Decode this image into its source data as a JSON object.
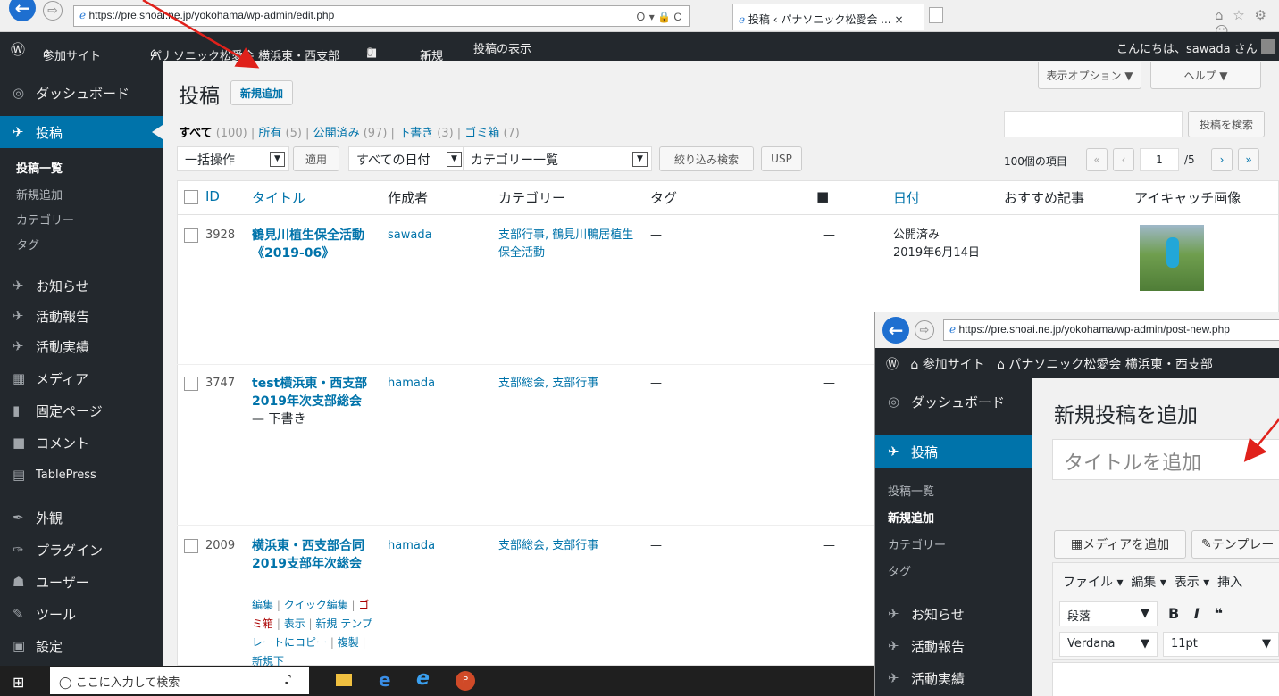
{
  "browser": {
    "url": "https://pre.shoai.ne.jp/yokohama/wp-admin/edit.php",
    "search_glyph": "Ｏ ▾ 🔒 C",
    "tab_title": "投稿 ‹ パナソニック松愛会 ...",
    "tab_close": "×",
    "right_icons": "⌂ ☆ ⚙ ☺"
  },
  "adminbar": {
    "wp_icon": "Ⓦ",
    "mysites": "参加サイト",
    "site": "パナソニック松愛会 横浜東・西支部",
    "comments": "0",
    "new": "新規",
    "view": "投稿の表示",
    "greeting": "こんにちは、sawada さん"
  },
  "sidebar": {
    "dashboard": "ダッシュボード",
    "posts": "投稿",
    "sub": [
      "投稿一覧",
      "新規追加",
      "カテゴリー",
      "タグ"
    ],
    "items": [
      "お知らせ",
      "活動報告",
      "活動実績",
      "メディア",
      "固定ページ",
      "コメント",
      "TablePress",
      "外観",
      "プラグイン",
      "ユーザー",
      "ツール",
      "設定"
    ]
  },
  "main": {
    "title": "投稿",
    "add_new": "新規追加",
    "screen_options": "表示オプション ▼",
    "help": "ヘルプ ▼",
    "filters": {
      "all": "すべて",
      "all_count": "(100)",
      "mine": "所有",
      "mine_count": "(5)",
      "published": "公開済み",
      "published_count": "(97)",
      "draft": "下書き",
      "draft_count": "(3)",
      "trash": "ゴミ箱",
      "trash_count": "(7)"
    },
    "search_button": "投稿を検索",
    "bulk": "一括操作",
    "apply": "適用",
    "dates": "すべての日付",
    "categories": "カテゴリー一覧",
    "filter": "絞り込み検索",
    "usp": "USP",
    "items_count": "100個の項目",
    "page": "1",
    "pages": "/5",
    "columns": [
      "ID",
      "タイトル",
      "作成者",
      "カテゴリー",
      "タグ",
      "日付",
      "おすすめ記事",
      "アイキャッチ画像"
    ],
    "rows": [
      {
        "id": "3928",
        "title": "鶴見川植生保全活動《2019-06》",
        "author": "sawada",
        "cats": "支部行事, 鶴見川鴨居植生保全活動",
        "tags": "—",
        "comments": "—",
        "status": "公開済み",
        "date": "2019年6月14日"
      },
      {
        "id": "3747",
        "title": "test横浜東・西支部2019年次支部総会",
        "state": "— 下書き",
        "author": "hamada",
        "cats": "支部総会, 支部行事",
        "tags": "—",
        "comments": "—"
      },
      {
        "id": "2009",
        "title": "横浜東・西支部合同　2019支部年次総会",
        "author": "hamada",
        "cats": "支部総会, 支部行事",
        "tags": "—",
        "comments": "—",
        "actions": {
          "edit": "編集",
          "quick": "クイック編集",
          "trash": "ゴミ箱",
          "view": "表示",
          "newitem": "新規",
          "template": "テンプレートにコピー",
          "dup": "複製",
          "newdraft": "新規下"
        }
      }
    ]
  },
  "taskbar": {
    "search": "ここに入力して検索"
  },
  "overlay": {
    "url": "https://pre.shoai.ne.jp/yokohama/wp-admin/post-new.php",
    "mysites": "参加サイト",
    "site": "パナソニック松愛会 横浜東・西支部",
    "dashboard": "ダッシュボード",
    "posts": "投稿",
    "sub": [
      "投稿一覧",
      "新規追加",
      "カテゴリー",
      "タグ"
    ],
    "items": [
      "お知らせ",
      "活動報告",
      "活動実績"
    ],
    "heading": "新規投稿を追加",
    "title_placeholder": "タイトルを追加",
    "add_media": "メディアを追加",
    "template": "テンプレー",
    "menus": [
      "ファイル ▾",
      "編集 ▾",
      "表示 ▾",
      "挿入"
    ],
    "para": "段落",
    "font": "Verdana",
    "size": "11pt"
  },
  "colors": {
    "adminbar": "#23282d",
    "accent": "#0073aa",
    "arrow": "#e0211b"
  }
}
